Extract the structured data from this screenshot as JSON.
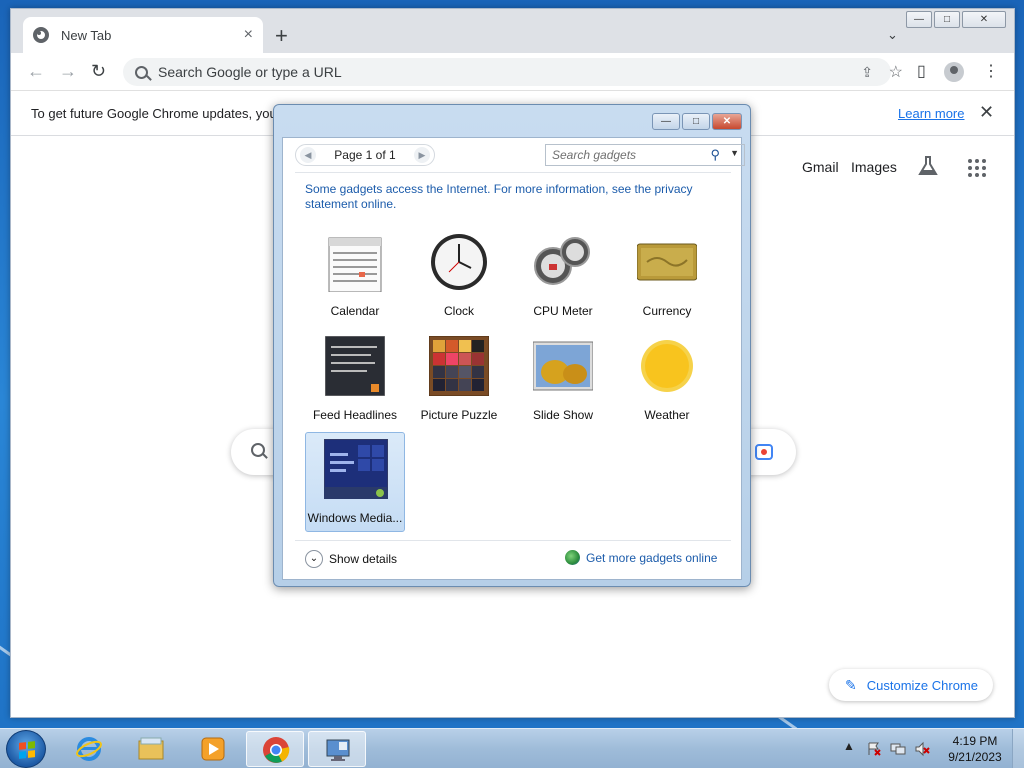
{
  "browser": {
    "tab_title": "New Tab",
    "tab_close": "×",
    "new_tab": "+",
    "tab_search": "⌄",
    "window_caps": {
      "minimize": "—",
      "maximize": "□",
      "close": "✕"
    },
    "omnibox_placeholder": "Search Google or type a URL",
    "infobar": {
      "text": "To get future Google Chrome updates, you",
      "learn_more": "Learn more",
      "close": "✕"
    },
    "ntp": {
      "gmail": "Gmail",
      "images": "Images",
      "customize": "Customize Chrome"
    }
  },
  "gadgets_window": {
    "page_label": "Page 1 of 1",
    "search_placeholder": "Search gadgets",
    "notice": "Some gadgets access the Internet.  For more information, see the privacy statement online.",
    "gadgets": [
      {
        "label": "Calendar"
      },
      {
        "label": "Clock"
      },
      {
        "label": "CPU Meter"
      },
      {
        "label": "Currency"
      },
      {
        "label": "Feed Headlines"
      },
      {
        "label": "Picture Puzzle"
      },
      {
        "label": "Slide Show"
      },
      {
        "label": "Weather"
      },
      {
        "label": "Windows Media...",
        "selected": true
      }
    ],
    "show_details": "Show details",
    "get_more": "Get more gadgets online"
  },
  "taskbar": {
    "time": "4:19 PM",
    "date": "9/21/2023",
    "tray_arrow": "▲"
  }
}
